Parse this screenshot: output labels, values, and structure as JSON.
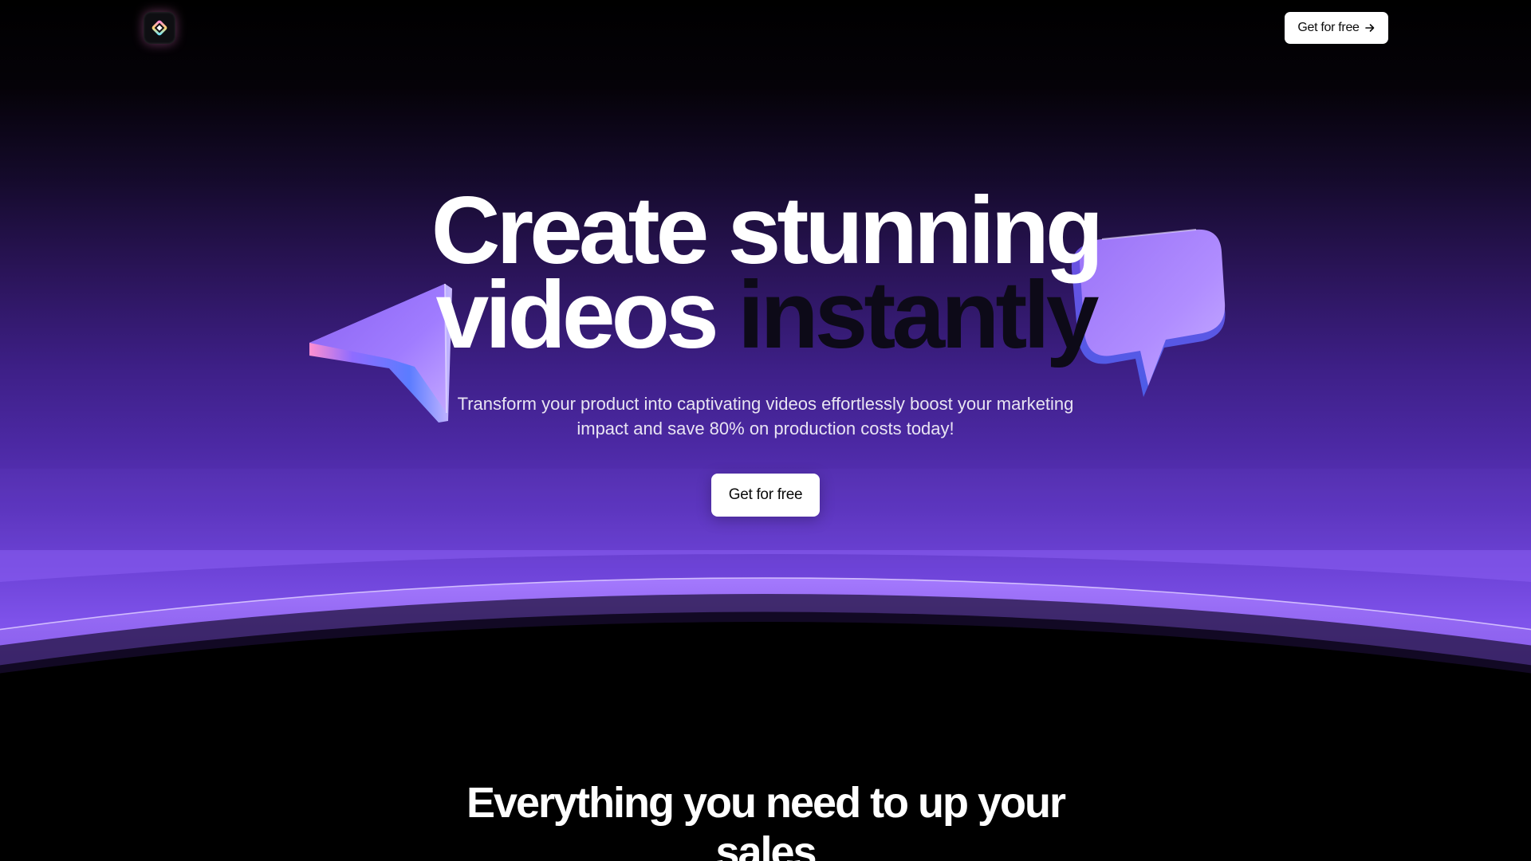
{
  "nav": {
    "logo_icon": "diamond-logo-icon",
    "cta_label": "Get for free",
    "cta_icon": "arrow-right-icon"
  },
  "hero": {
    "headline_line1": "Create stunning",
    "headline_line2_white": "videos",
    "headline_line2_dark": "instantly",
    "subtitle": "Transform your product into captivating videos effortlessly boost your marketing impact and save 80% on production costs today!",
    "cta_label": "Get for free",
    "decor_left": "3d-cursor-pointer-icon",
    "decor_right": "3d-chat-bubble-icon"
  },
  "features": {
    "title": "Everything you need to up your sales"
  },
  "colors": {
    "background": "#000000",
    "accent_purple": "#8a5ef3",
    "button_bg": "#ffffff",
    "button_text": "#0a0a0a",
    "headline_dark_word": "#0d0a18"
  }
}
